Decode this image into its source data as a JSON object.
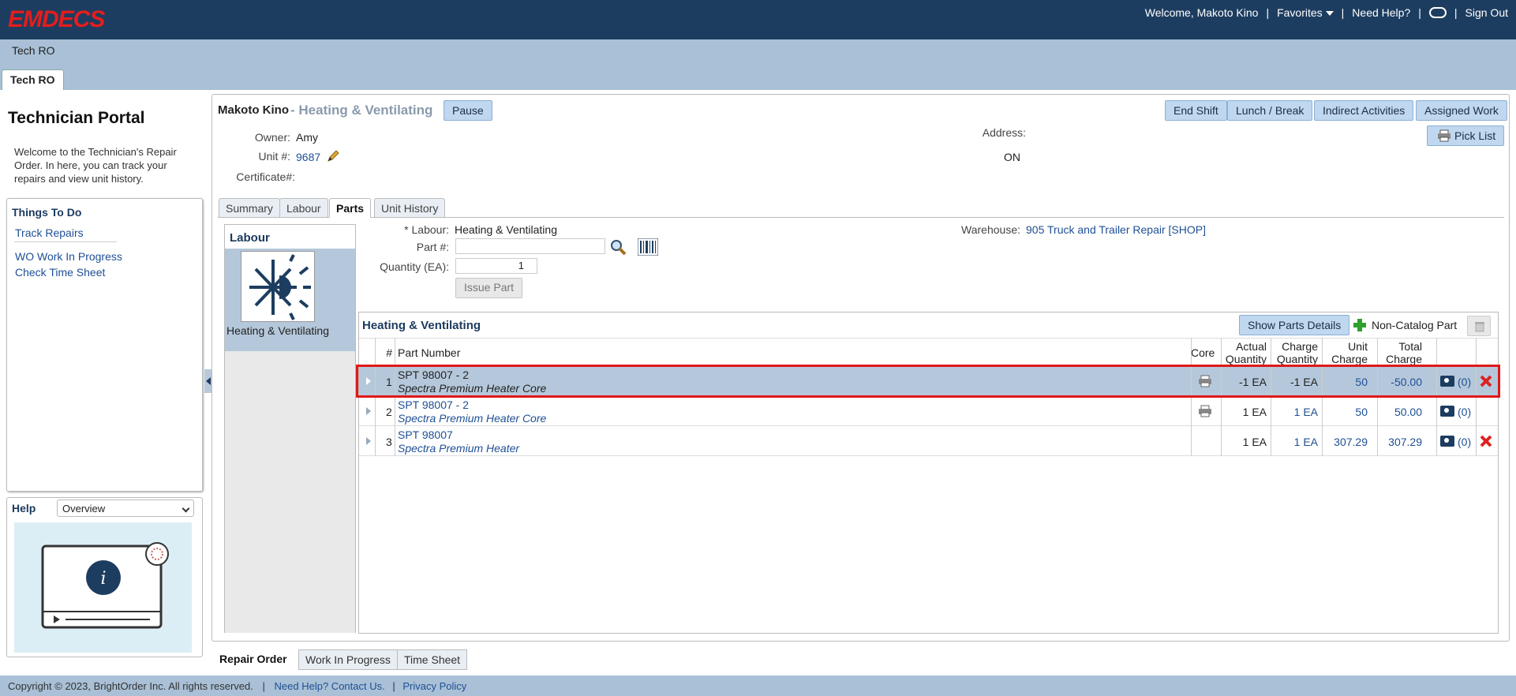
{
  "brand": {
    "logo_text": "EMDECS"
  },
  "topnav": {
    "welcome": "Welcome, Makoto Kino",
    "favorites": "Favorites",
    "need_help": "Need Help?",
    "sign_out": "Sign Out"
  },
  "app": {
    "name": "Tech RO",
    "tab": "Tech RO"
  },
  "left": {
    "title": "Technician Portal",
    "intro": "Welcome to the Technician's Repair Order. In here, you can track your repairs and view unit history.",
    "todo_title": "Things To Do",
    "todo_items": [
      "Track Repairs",
      "WO Work In Progress",
      "Check Time Sheet"
    ],
    "help_title": "Help",
    "help_select": "Overview"
  },
  "header": {
    "tech_name": "Makoto Kino",
    "job": "- Heating & Ventilating",
    "pause": "Pause",
    "owner_label": "Owner:",
    "owner": "Amy",
    "unit_label": "Unit #:",
    "unit": "9687",
    "cert_label": "Certificate#:",
    "address_label": "Address:",
    "address_value": "ON",
    "buttons": [
      "End Shift",
      "Lunch / Break",
      "Indirect Activities",
      "Assigned Work"
    ],
    "pick_list": "Pick List"
  },
  "tabs": [
    "Summary",
    "Labour",
    "Parts",
    "Unit History"
  ],
  "labour": {
    "title": "Labour",
    "item": "Heating & Ventilating"
  },
  "form": {
    "labour_label": "* Labour:",
    "labour_value": "Heating & Ventilating",
    "part_label": "Part #:",
    "qty_label": "Quantity (EA):",
    "qty_value": "1",
    "issue": "Issue Part",
    "warehouse_label": "Warehouse:",
    "warehouse": "905 Truck and Trailer Repair [SHOP]"
  },
  "grid": {
    "title": "Heating & Ventilating",
    "show_details": "Show Parts Details",
    "non_catalog": "Non-Catalog Part",
    "headers": {
      "num": "#",
      "part": "Part Number",
      "core": "Core",
      "actual1": "Actual",
      "actual2": "Quantity",
      "charge1": "Charge",
      "charge2": "Quantity",
      "unit1": "Unit",
      "unit2": "Charge",
      "total1": "Total",
      "total2": "Charge"
    },
    "rows": [
      {
        "num": "1",
        "part": "SPT 98007 - 2",
        "desc": "Spectra Premium Heater Core",
        "actual": "-1 EA",
        "charge": "-1 EA",
        "unit": "50",
        "total": "-50.00",
        "photos": "(0)"
      },
      {
        "num": "2",
        "part": "SPT 98007 - 2",
        "desc": "Spectra Premium Heater Core",
        "actual": "1 EA",
        "charge": "1 EA",
        "unit": "50",
        "total": "50.00",
        "photos": "(0)"
      },
      {
        "num": "3",
        "part": "SPT 98007",
        "desc": "Spectra Premium Heater",
        "actual": "1 EA",
        "charge": "1 EA",
        "unit": "307.29",
        "total": "307.29",
        "photos": "(0)"
      }
    ]
  },
  "bottom_tabs": [
    "Repair Order",
    "Work In Progress",
    "Time Sheet"
  ],
  "footer": {
    "copyright": "Copyright © 2023, BrightOrder Inc. All rights reserved.",
    "help": "Need Help? Contact Us.",
    "privacy": "Privacy Policy"
  }
}
